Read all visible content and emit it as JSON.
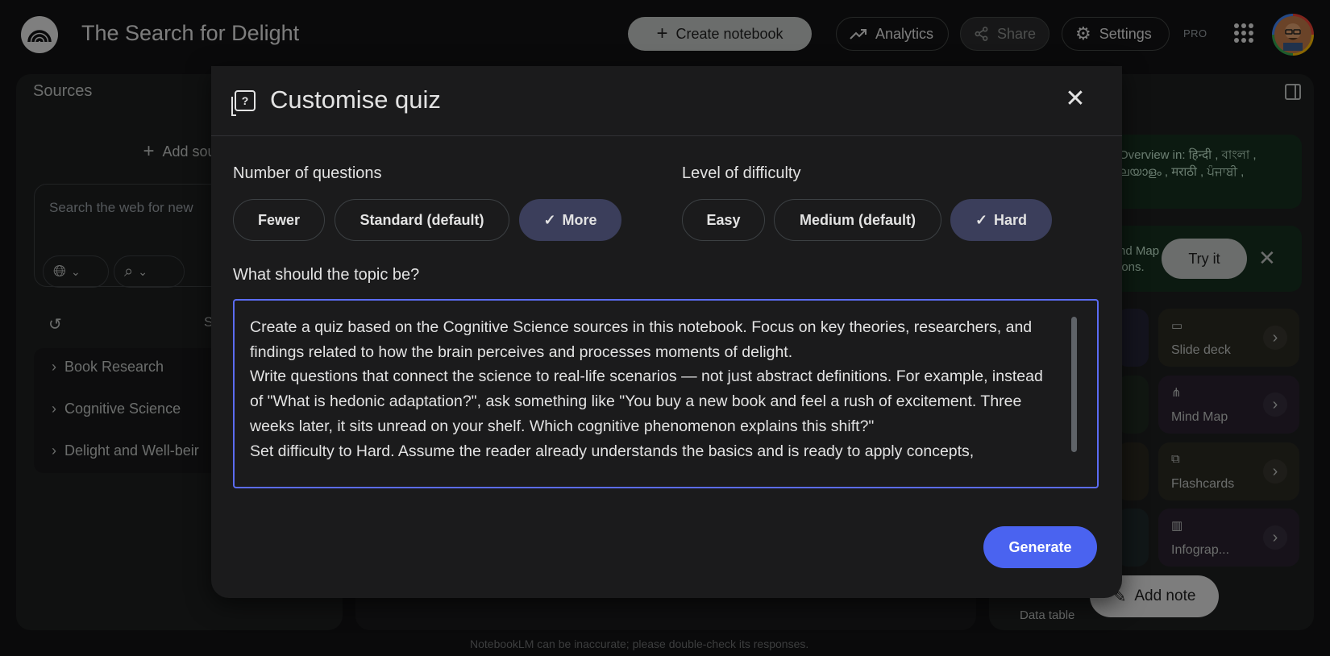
{
  "header": {
    "notebook_title": "The Search for Delight",
    "create_label": "Create notebook",
    "analytics_label": "Analytics",
    "share_label": "Share",
    "settings_label": "Settings",
    "pro_badge": "PRO"
  },
  "sources": {
    "title": "Sources",
    "add_label": "Add sourc",
    "search_placeholder": "Search the web for new",
    "select_all_partial": "S",
    "folders": [
      {
        "label": "Book Research"
      },
      {
        "label": "Cognitive Science"
      },
      {
        "label": "Delight and Well-beir"
      }
    ]
  },
  "studio": {
    "overview_line1": "Overview in: हिन्दी , বাংলা ,",
    "overview_line2": "ലയാളം , मराठी , ਪੰਜਾਬੀ ,",
    "mindmap_line1": "nd Map",
    "mindmap_line2": "ions.",
    "try_it_label": "Try it",
    "tools": [
      {
        "label": "Slide deck",
        "icon": "slide-deck-icon"
      },
      {
        "label": "Mind Map",
        "icon": "mind-map-icon"
      },
      {
        "label": "Flashcards",
        "icon": "flashcards-icon"
      },
      {
        "label": "Infograp...",
        "icon": "infographic-icon"
      }
    ],
    "add_note_label": "Add note",
    "data_table_label": "Data table"
  },
  "footer_note": "NotebookLM can be inaccurate; please double-check its responses.",
  "modal": {
    "title": "Customise quiz",
    "questions_label": "Number of questions",
    "questions_options": [
      "Fewer",
      "Standard (default)",
      "More"
    ],
    "questions_selected": "More",
    "difficulty_label": "Level of difficulty",
    "difficulty_options": [
      "Easy",
      "Medium (default)",
      "Hard"
    ],
    "difficulty_selected": "Hard",
    "topic_label": "What should the topic be?",
    "topic_value": "Create a quiz based on the Cognitive Science sources in this notebook. Focus on key theories, researchers, and findings related to how the brain perceives and processes moments of delight.\nWrite questions that connect the science to real-life scenarios — not just abstract definitions. For example, instead of \"What is hedonic adaptation?\", ask something like \"You buy a new book and feel a rush of excitement. Three weeks later, it sits unread on your shelf. Which cognitive phenomenon explains this shift?\"\nSet difficulty to Hard. Assume the reader already understands the basics and is ready to apply concepts,",
    "generate_label": "Generate"
  },
  "colors": {
    "accent": "#4a63f0",
    "focus_border": "#5b6cf4",
    "selected_chip": "#3b3e5b"
  }
}
